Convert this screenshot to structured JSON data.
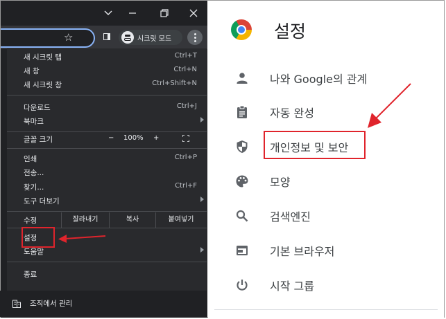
{
  "window_controls": [
    "chevron-down",
    "restore",
    "close"
  ],
  "toolbar": {
    "incognito_label": "시크릿 모드"
  },
  "menu": {
    "group1": [
      {
        "label": "새 시크릿 탭",
        "shortcut": "Ctrl+T"
      },
      {
        "label": "새 창",
        "shortcut": "Ctrl+N"
      },
      {
        "label": "새 시크릿 창",
        "shortcut": "Ctrl+Shift+N"
      }
    ],
    "group2": [
      {
        "label": "다운로드",
        "shortcut": "Ctrl+J"
      },
      {
        "label": "북마크",
        "shortcut": ""
      }
    ],
    "zoom": {
      "label": "글꼴 크기",
      "minus": "−",
      "value": "100%",
      "plus": "+"
    },
    "group3": [
      {
        "label": "인쇄",
        "shortcut": "Ctrl+P"
      },
      {
        "label": "전송...",
        "shortcut": ""
      },
      {
        "label": "찾기...",
        "shortcut": "Ctrl+F"
      },
      {
        "label": "도구 더보기",
        "shortcut": ""
      }
    ],
    "edit": {
      "label": "수정",
      "cut": "잘라내기",
      "copy": "복사",
      "paste": "붙여넣기"
    },
    "group4": [
      {
        "label": "설정"
      },
      {
        "label": "도움말"
      }
    ],
    "exit": {
      "label": "종료"
    },
    "org": {
      "label": "조직에서 관리"
    }
  },
  "settings": {
    "title": "설정",
    "nav": [
      {
        "icon": "person-icon",
        "label_brand": "나와 Google의 관계"
      },
      {
        "icon": "clipboard-icon",
        "label": "자동 완성"
      },
      {
        "icon": "shield-icon",
        "label": "개인정보 및 보안"
      },
      {
        "icon": "palette-icon",
        "label": "모양"
      },
      {
        "icon": "search-icon",
        "label": "검색엔진"
      },
      {
        "icon": "browser-icon",
        "label": "기본 브라우저"
      },
      {
        "icon": "power-icon",
        "label": "시작 그룹"
      }
    ]
  },
  "annotation_color": "#e0242c"
}
